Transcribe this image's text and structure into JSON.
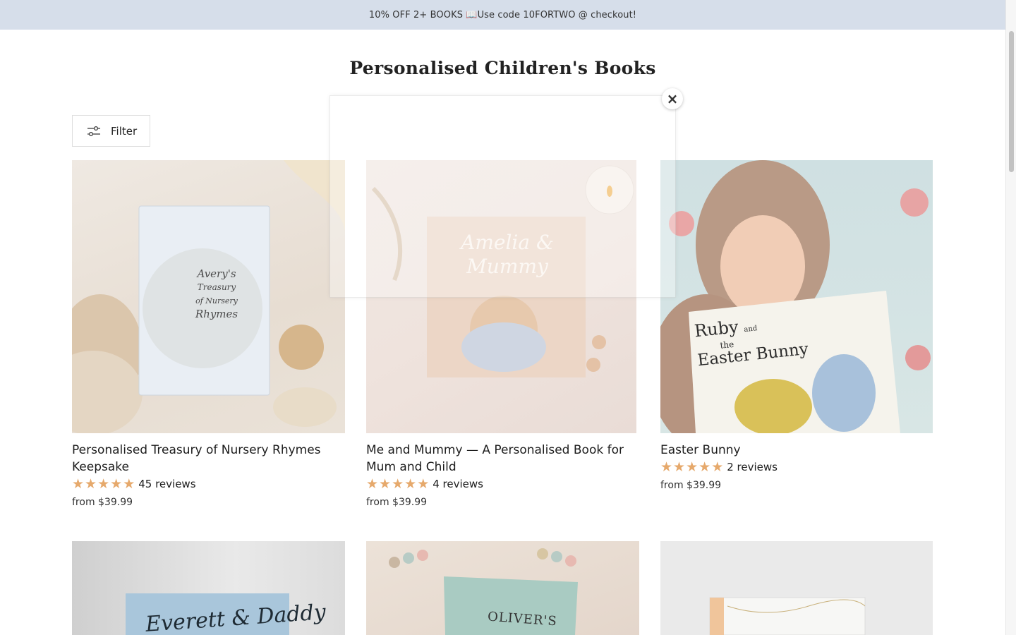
{
  "announcement": "10% OFF 2+ BOOKS 📖Use code 10FORTWO @ checkout!",
  "page_title": "Personalised Children's Books",
  "filter_label": "Filter",
  "popup": {
    "close_glyph": "×"
  },
  "products": [
    {
      "title": "Personalised Treasury of Nursery Rhymes Keepsake",
      "stars": 5,
      "reviews": "45 reviews",
      "price": "from $39.99",
      "cover_text": [
        "Avery's",
        "Treasury",
        "of Nursery",
        "Rhymes"
      ]
    },
    {
      "title": "Me and Mummy — A Personalised Book for Mum and Child",
      "stars": 5,
      "reviews": "4 reviews",
      "price": "from $39.99",
      "cover_text": [
        "Amelia &",
        "Mummy"
      ]
    },
    {
      "title": "Easter Bunny",
      "stars": 5,
      "reviews": "2 reviews",
      "price": "from $39.99",
      "cover_text": [
        "Ruby",
        "and",
        "the",
        "Easter Bunny"
      ]
    }
  ],
  "products_row2": [
    {
      "cover_text": "Everett & Daddy"
    },
    {
      "cover_text": "OLIVER'S"
    },
    {
      "cover_text": ""
    }
  ],
  "colors": {
    "announcement_bg": "#d6deea",
    "star": "#e6a96c"
  }
}
